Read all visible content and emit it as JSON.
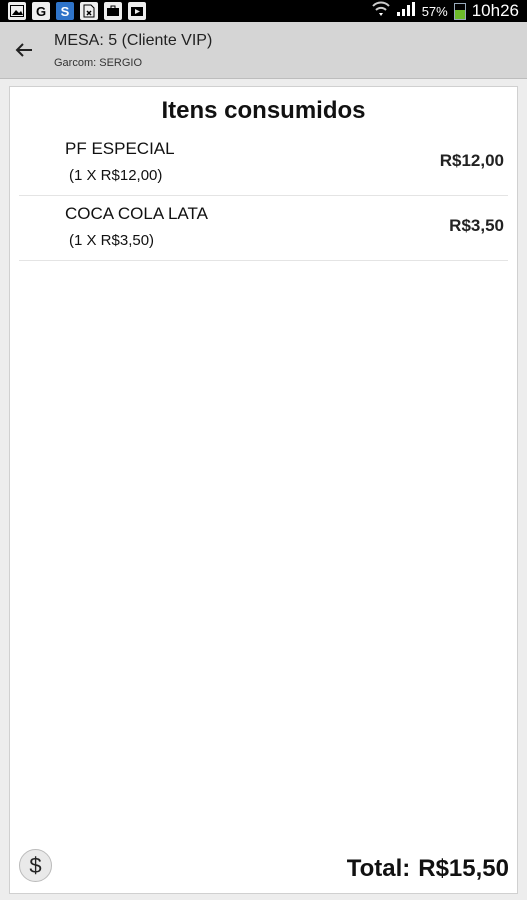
{
  "status_bar": {
    "left_icons": [
      "image-icon",
      "g-icon",
      "skype-icon",
      "file-x-icon",
      "briefcase-icon",
      "play-store-icon"
    ],
    "battery_percent_label": "57%",
    "battery_level": 0.57,
    "time": "10h26"
  },
  "action_bar": {
    "title": "MESA: 5 (Cliente VIP)",
    "subtitle": "Garcom: SERGIO"
  },
  "order": {
    "heading": "Itens consumidos",
    "items": [
      {
        "name": "PF ESPECIAL",
        "detail": "(1 X R$12,00)",
        "price": "R$12,00"
      },
      {
        "name": "COCA COLA LATA",
        "detail": "(1 X R$3,50)",
        "price": "R$3,50"
      }
    ],
    "pay_button_symbol": "$",
    "total_label": "Total:",
    "total_value": "R$15,50"
  },
  "colors": {
    "action_bar_bg": "#d5d5d5",
    "battery_fill": "#6dbb2b",
    "status_bar_bg": "#000000"
  }
}
